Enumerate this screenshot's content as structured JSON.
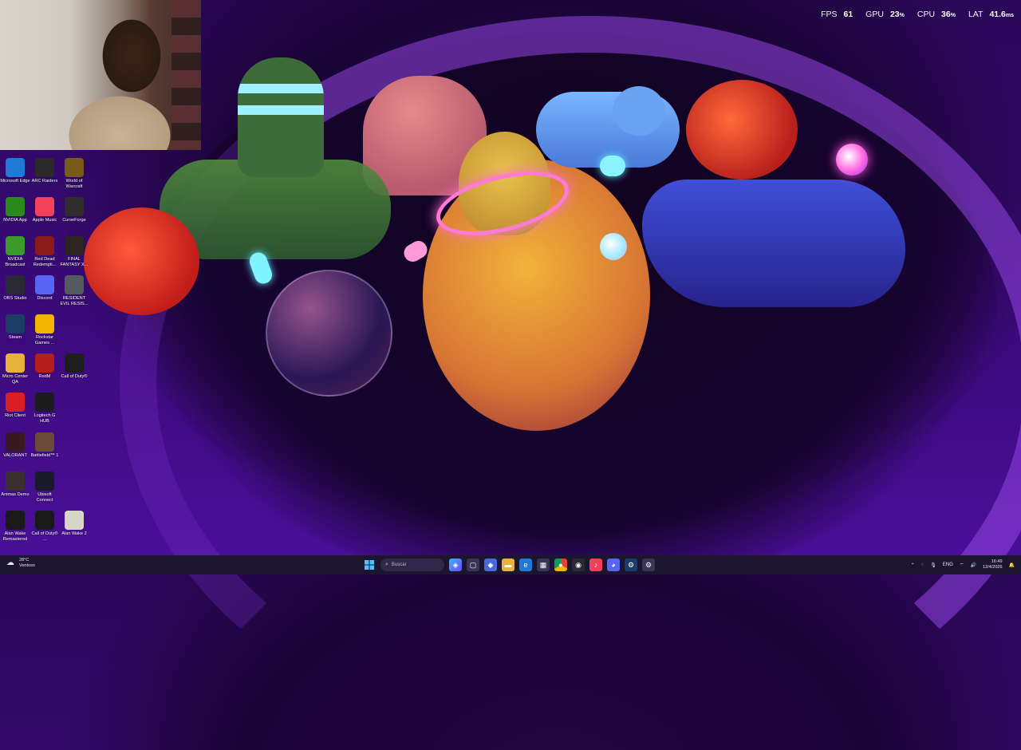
{
  "hud": {
    "fps": {
      "label": "FPS",
      "value": "61"
    },
    "gpu": {
      "label": "GPU",
      "value": "23",
      "unit": "%"
    },
    "cpu": {
      "label": "CPU",
      "value": "36",
      "unit": "%"
    },
    "lat": {
      "label": "LAT",
      "value": "41.6",
      "unit": "ms"
    }
  },
  "desktop_icons": [
    {
      "label": "Microsoft Edge",
      "icon": "edge-icon",
      "color": "#1e7ad6"
    },
    {
      "label": "ARC Raiders",
      "icon": "arc-raiders-icon",
      "color": "#2a2a2a"
    },
    {
      "label": "World of Warcraft",
      "icon": "wow-icon",
      "color": "#7a5a1a"
    },
    {
      "label": "NVIDIA App",
      "icon": "nvidia-icon",
      "color": "#2b8a1e"
    },
    {
      "label": "Apple Music",
      "icon": "music-icon",
      "color": "#f0425a"
    },
    {
      "label": "CurseForge",
      "icon": "curseforge-icon",
      "color": "#2d2d2d"
    },
    {
      "label": "NVIDIA Broadcast",
      "icon": "nvidia-broadcast-icon",
      "color": "#3b9a2a"
    },
    {
      "label": "Red Dead Redempti...",
      "icon": "rdr-icon",
      "color": "#8a1a1a"
    },
    {
      "label": "FINAL FANTASY X...",
      "icon": "ff-icon",
      "color": "#2a2520"
    },
    {
      "label": "OBS Studio",
      "icon": "obs-icon",
      "color": "#2a2a36"
    },
    {
      "label": "Discord",
      "icon": "discord-icon",
      "color": "#5865f2"
    },
    {
      "label": "RESIDENT EVIL RESIS...",
      "icon": "re-icon",
      "color": "#555a60"
    },
    {
      "label": "Steam",
      "icon": "steam-icon",
      "color": "#1b3d66"
    },
    {
      "label": "Rockstar Games ...",
      "icon": "rockstar-icon",
      "color": "#f2b400"
    },
    {
      "label": "Micro Center QA",
      "icon": "folder-icon",
      "color": "#e8b23a"
    },
    {
      "label": "RedM",
      "icon": "redm-icon",
      "color": "#b51d1d"
    },
    {
      "label": "Call of Duty®",
      "icon": "cod-icon",
      "color": "#1e1e1e"
    },
    {
      "label": "Riot Client",
      "icon": "riot-icon",
      "color": "#d91f26"
    },
    {
      "label": "Logitech G HUB",
      "icon": "logitech-icon",
      "color": "#1c1c1c"
    },
    {
      "label": "VALORANT",
      "icon": "valorant-icon",
      "color": "#3a1a22"
    },
    {
      "label": "Battlefield™ 1",
      "icon": "battlefield-icon",
      "color": "#6b4a3a"
    },
    {
      "label": "Animas Demo",
      "icon": "animas-icon",
      "color": "#3a3030"
    },
    {
      "label": "Ubisoft Connect",
      "icon": "ubisoft-icon",
      "color": "#1a1a2a"
    },
    {
      "label": "Alan Wake Remastered",
      "icon": "alan-wake-icon",
      "color": "#1a1a1a"
    },
    {
      "label": "Call of Duty® ...",
      "icon": "cod-mw-icon",
      "color": "#1a1a1a"
    },
    {
      "label": "Alan Wake 2",
      "icon": "alan-wake-2-icon",
      "color": "#d8d6c8"
    }
  ],
  "taskbar": {
    "weather": {
      "temp": "28°C",
      "condition": "Ventoso"
    },
    "search_placeholder": "Buscar",
    "tray_lang": "ENG",
    "time": "16:49",
    "date": "12/4/2026"
  }
}
